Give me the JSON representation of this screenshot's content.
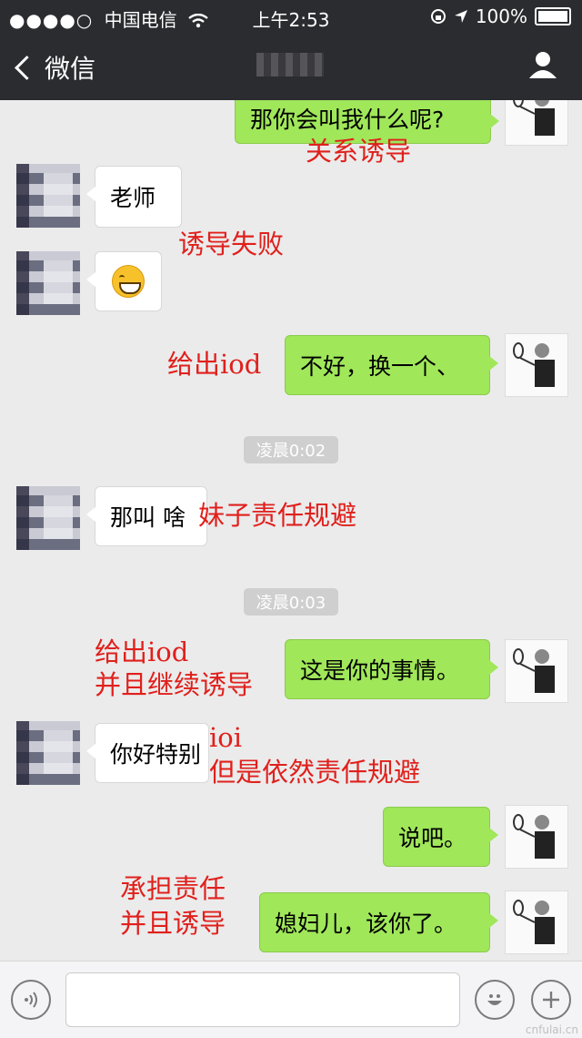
{
  "status_bar": {
    "signal_dots": "●●●●○",
    "carrier": "中国电信",
    "time": "上午2:53",
    "battery": "100%"
  },
  "nav": {
    "back_label": "微信"
  },
  "messages": [
    {
      "from": "me",
      "text": "那你会叫我什么呢?"
    },
    {
      "from": "them",
      "text": "老师"
    },
    {
      "from": "them",
      "emoji": "grinning-face-icon"
    },
    {
      "from": "me",
      "text": "不好，换一个、"
    },
    {
      "from": "time",
      "text": "凌晨0:02"
    },
    {
      "from": "them",
      "text": "那叫 啥"
    },
    {
      "from": "time",
      "text": "凌晨0:03"
    },
    {
      "from": "me",
      "text": "这是你的事情。"
    },
    {
      "from": "them",
      "text": "你好特别"
    },
    {
      "from": "me",
      "text": "说吧。"
    },
    {
      "from": "me",
      "text": "媳妇儿，该你了。"
    }
  ],
  "annotations": [
    "关系诱导",
    "诱导失败",
    "给出iod",
    "妹子责任规避",
    "给出iod",
    "并且继续诱导",
    "ioi",
    "但是依然责任规避",
    "承担责任",
    "并且诱导"
  ],
  "watermark": "cnfulai.cn",
  "colors": {
    "header_bg": "#2b2c30",
    "my_bubble": "#a0e75a",
    "their_bubble": "#ffffff",
    "annotation": "#e0201c"
  }
}
